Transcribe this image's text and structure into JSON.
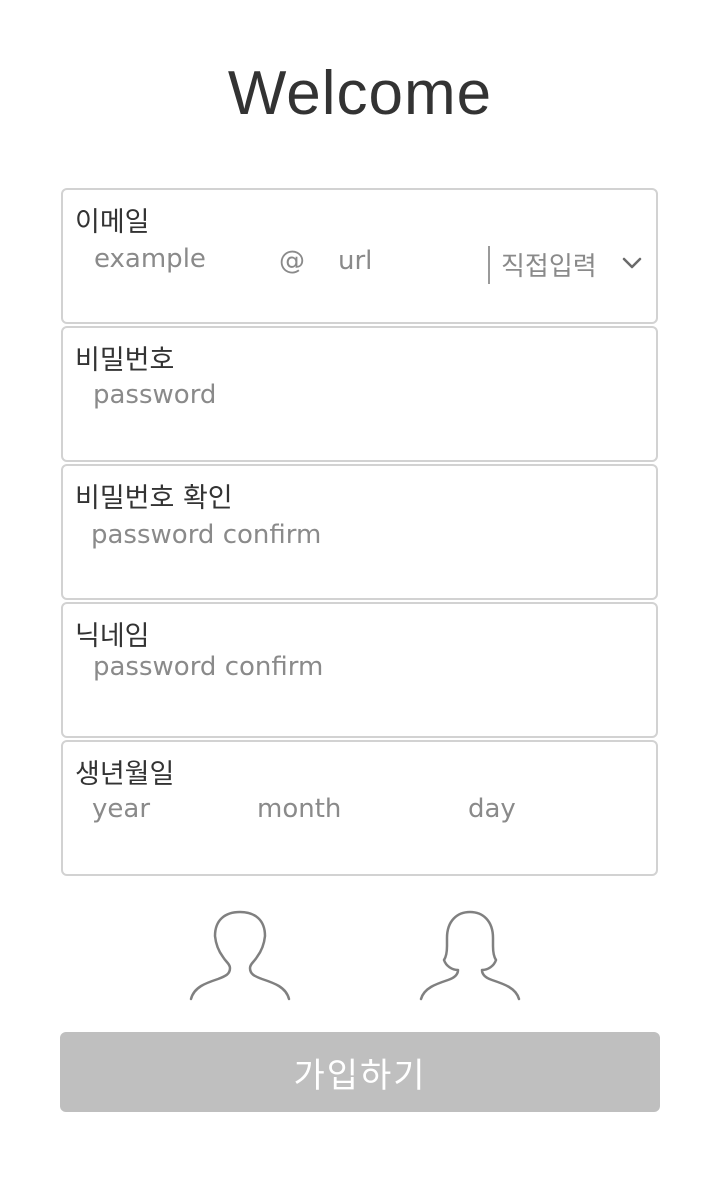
{
  "title": "Welcome",
  "email": {
    "label": "이메일",
    "local_placeholder": "example",
    "at": "@",
    "domain_placeholder": "url",
    "domain_select": "직접입력",
    "select_icon": "chevron-down-icon"
  },
  "password": {
    "label": "비밀번호",
    "placeholder": "password"
  },
  "password_confirm": {
    "label": "비밀번호 확인",
    "placeholder": "password confirm"
  },
  "nickname": {
    "label": "닉네임",
    "placeholder": "password confirm"
  },
  "birthdate": {
    "label": "생년월일",
    "year_placeholder": "year",
    "month_placeholder": "month",
    "day_placeholder": "day"
  },
  "gender": {
    "options": [
      {
        "icon": "male-user-icon"
      },
      {
        "icon": "female-user-icon"
      }
    ],
    "stroke_color": "#808080"
  },
  "submit": {
    "label": "가입하기",
    "background": "#bfbfbf",
    "text_color": "#ffffff"
  }
}
